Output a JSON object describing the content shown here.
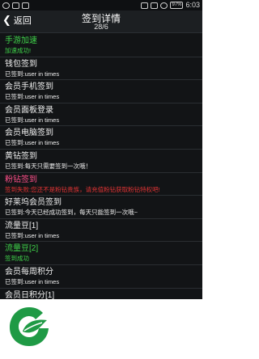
{
  "status_bar": {
    "time": "6:03",
    "battery": "97%",
    "left_icons": [
      "qq-icon",
      "notification-icon",
      "lock-icon"
    ],
    "right_icons": [
      "nfc-icon",
      "signal-4g-icon",
      "wifi-icon"
    ]
  },
  "header": {
    "back_label": "返回",
    "title": "签到详情",
    "subtitle": "28/6"
  },
  "items": [
    {
      "name": "手游加速",
      "status": "加速成功!",
      "color": "green"
    },
    {
      "name": "钱包签到",
      "status": "已签到:user in times",
      "color": "white"
    },
    {
      "name": "会员手机签到",
      "status": "已签到:user in times",
      "color": "white"
    },
    {
      "name": "会员面板登录",
      "status": "已签到:user in times",
      "color": "white"
    },
    {
      "name": "会员电脑签到",
      "status": "已签到:user in times",
      "color": "white"
    },
    {
      "name": "黄钻签到",
      "status": "已签到:每天只需要签到一次哦！",
      "color": "white"
    },
    {
      "name": "粉钻签到",
      "status": "签到失败:您还不是粉钻贵族，请充值粉钻获取粉钻特权吧!",
      "color": "pink"
    },
    {
      "name": "好莱坞会员签到",
      "status": "已签到:今天已经成功签到，每天只能签到一次哦~",
      "color": "white"
    },
    {
      "name": "流量豆[1]",
      "status": "已签到:user in times",
      "color": "white"
    },
    {
      "name": "流量豆[2]",
      "status": "签到成功",
      "color": "green"
    },
    {
      "name": "会员每周积分",
      "status": "已签到:user in times",
      "color": "white"
    },
    {
      "name": "会员日积分[1]",
      "status": "",
      "color": "white"
    }
  ],
  "logo": {
    "icon": "leaf-logo-icon",
    "color": "#1f9a45"
  }
}
